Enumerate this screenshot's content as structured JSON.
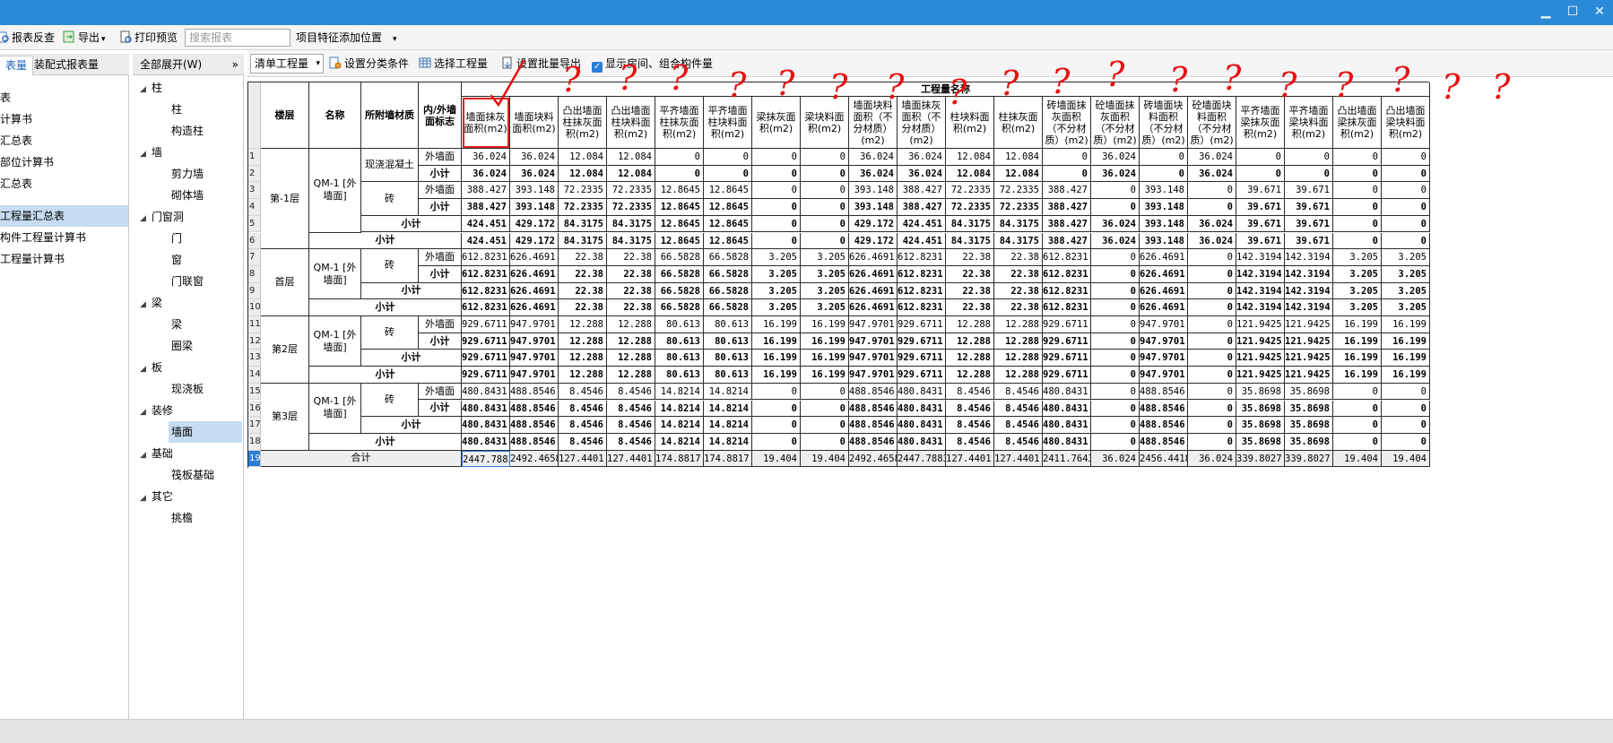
{
  "window": {
    "minimize": "▁",
    "maximize": "☐",
    "close": "✕"
  },
  "toolbar": {
    "report_check": "报表反查",
    "export": "导出",
    "print_preview": "打印预览",
    "search_placeholder": "搜索报表",
    "feature_position": "项目特征添加位置"
  },
  "left_panel": {
    "tabs": [
      "表量",
      "装配式报表量"
    ],
    "items": [
      {
        "label": "表",
        "selected": false
      },
      {
        "label": "计算书",
        "selected": false
      },
      {
        "label": "汇总表",
        "selected": false
      },
      {
        "label": "部位计算书",
        "selected": false
      },
      {
        "label": "汇总表",
        "selected": false
      },
      {
        "label": "工程量汇总表",
        "selected": true
      },
      {
        "label": "构件工程量计算书",
        "selected": false
      },
      {
        "label": "工程量计算书",
        "selected": false
      }
    ]
  },
  "tree": {
    "expand_all": "全部展开(W)",
    "collapse_glyph": "»",
    "nodes": [
      {
        "type": "group",
        "label": "柱"
      },
      {
        "type": "leaf",
        "label": "柱"
      },
      {
        "type": "leaf",
        "label": "构造柱"
      },
      {
        "type": "group",
        "label": "墙"
      },
      {
        "type": "leaf",
        "label": "剪力墙"
      },
      {
        "type": "leaf",
        "label": "砌体墙"
      },
      {
        "type": "group",
        "label": "门窗洞"
      },
      {
        "type": "leaf",
        "label": "门"
      },
      {
        "type": "leaf",
        "label": "窗"
      },
      {
        "type": "leaf",
        "label": "门联窗"
      },
      {
        "type": "group",
        "label": "梁"
      },
      {
        "type": "leaf",
        "label": "梁"
      },
      {
        "type": "leaf",
        "label": "圈梁"
      },
      {
        "type": "group",
        "label": "板"
      },
      {
        "type": "leaf",
        "label": "现浇板"
      },
      {
        "type": "group",
        "label": "装修"
      },
      {
        "type": "leaf",
        "label": "墙面",
        "selected": true
      },
      {
        "type": "group",
        "label": "基础"
      },
      {
        "type": "leaf",
        "label": "筏板基础"
      },
      {
        "type": "group",
        "label": "其它"
      },
      {
        "type": "leaf",
        "label": "挑檐"
      }
    ]
  },
  "report_toolbar": {
    "mode_select": "清单工程量",
    "set_category": "设置分类条件",
    "select_quantity": "选择工程量",
    "batch_export": "设置批量导出",
    "show_rooms": "显示房间、组合构件量",
    "show_rooms_checked": true
  },
  "table": {
    "group_header": "工程量名称",
    "fixed_headers": [
      "楼层",
      "名称",
      "所附墙材质",
      "内/外墙面标志"
    ],
    "columns": [
      "墙面抹灰面积(m2)",
      "墙面块料面积(m2)",
      "凸出墙面柱抹灰面积(m2)",
      "凸出墙面柱块料面积(m2)",
      "平齐墙面柱抹灰面积(m2)",
      "平齐墙面柱块料面积(m2)",
      "梁抹灰面积(m2)",
      "梁块料面积(m2)",
      "墙面块料面积（不分材质）(m2)",
      "墙面抹灰面积（不分材质）(m2)",
      "柱块料面积(m2)",
      "柱抹灰面积(m2)",
      "砖墙面抹灰面积（不分材质）(m2)",
      "砼墙面抹灰面积（不分材质）(m2)",
      "砖墙面块料面积（不分材质）(m2)",
      "砼墙面块料面积（不分材质）(m2)",
      "平齐墙面梁抹灰面积(m2)",
      "平齐墙面梁块料面积(m2)",
      "凸出墙面梁抹灰面积(m2)",
      "凸出墙面梁块料面积(m2)"
    ],
    "floors": [
      "第-1层",
      "首层",
      "第2层",
      "第3层"
    ],
    "name_label": "QM-1 [外墙面]",
    "materials": {
      "concrete": "现浇混凝土",
      "brick": "砖"
    },
    "flag_outer": "外墙面",
    "subtotal": "小计",
    "total": "合计",
    "row_numbers": [
      "1",
      "2",
      "3",
      "4",
      "5",
      "6",
      "7",
      "8",
      "9",
      "10",
      "11",
      "12",
      "13",
      "14",
      "15",
      "16",
      "17",
      "18",
      "19"
    ],
    "rows": [
      [
        "36.024",
        "36.024",
        "12.084",
        "12.084",
        "0",
        "0",
        "0",
        "0",
        "36.024",
        "36.024",
        "12.084",
        "12.084",
        "0",
        "36.024",
        "0",
        "36.024",
        "0",
        "0",
        "0",
        "0"
      ],
      [
        "36.024",
        "36.024",
        "12.084",
        "12.084",
        "0",
        "0",
        "0",
        "0",
        "36.024",
        "36.024",
        "12.084",
        "12.084",
        "0",
        "36.024",
        "0",
        "36.024",
        "0",
        "0",
        "0",
        "0"
      ],
      [
        "388.427",
        "393.148",
        "72.2335",
        "72.2335",
        "12.8645",
        "12.8645",
        "0",
        "0",
        "393.148",
        "388.427",
        "72.2335",
        "72.2335",
        "388.427",
        "0",
        "393.148",
        "0",
        "39.671",
        "39.671",
        "0",
        "0"
      ],
      [
        "388.427",
        "393.148",
        "72.2335",
        "72.2335",
        "12.8645",
        "12.8645",
        "0",
        "0",
        "393.148",
        "388.427",
        "72.2335",
        "72.2335",
        "388.427",
        "0",
        "393.148",
        "0",
        "39.671",
        "39.671",
        "0",
        "0"
      ],
      [
        "424.451",
        "429.172",
        "84.3175",
        "84.3175",
        "12.8645",
        "12.8645",
        "0",
        "0",
        "429.172",
        "424.451",
        "84.3175",
        "84.3175",
        "388.427",
        "36.024",
        "393.148",
        "36.024",
        "39.671",
        "39.671",
        "0",
        "0"
      ],
      [
        "424.451",
        "429.172",
        "84.3175",
        "84.3175",
        "12.8645",
        "12.8645",
        "0",
        "0",
        "429.172",
        "424.451",
        "84.3175",
        "84.3175",
        "388.427",
        "36.024",
        "393.148",
        "36.024",
        "39.671",
        "39.671",
        "0",
        "0"
      ],
      [
        "612.8231",
        "626.4691",
        "22.38",
        "22.38",
        "66.5828",
        "66.5828",
        "3.205",
        "3.205",
        "626.4691",
        "612.8231",
        "22.38",
        "22.38",
        "612.8231",
        "0",
        "626.4691",
        "0",
        "142.3194",
        "142.3194",
        "3.205",
        "3.205"
      ],
      [
        "612.8231",
        "626.4691",
        "22.38",
        "22.38",
        "66.5828",
        "66.5828",
        "3.205",
        "3.205",
        "626.4691",
        "612.8231",
        "22.38",
        "22.38",
        "612.8231",
        "0",
        "626.4691",
        "0",
        "142.3194",
        "142.3194",
        "3.205",
        "3.205"
      ],
      [
        "612.8231",
        "626.4691",
        "22.38",
        "22.38",
        "66.5828",
        "66.5828",
        "3.205",
        "3.205",
        "626.4691",
        "612.8231",
        "22.38",
        "22.38",
        "612.8231",
        "0",
        "626.4691",
        "0",
        "142.3194",
        "142.3194",
        "3.205",
        "3.205"
      ],
      [
        "612.8231",
        "626.4691",
        "22.38",
        "22.38",
        "66.5828",
        "66.5828",
        "3.205",
        "3.205",
        "626.4691",
        "612.8231",
        "22.38",
        "22.38",
        "612.8231",
        "0",
        "626.4691",
        "0",
        "142.3194",
        "142.3194",
        "3.205",
        "3.205"
      ],
      [
        "929.6711",
        "947.9701",
        "12.288",
        "12.288",
        "80.613",
        "80.613",
        "16.199",
        "16.199",
        "947.9701",
        "929.6711",
        "12.288",
        "12.288",
        "929.6711",
        "0",
        "947.9701",
        "0",
        "121.9425",
        "121.9425",
        "16.199",
        "16.199"
      ],
      [
        "929.6711",
        "947.9701",
        "12.288",
        "12.288",
        "80.613",
        "80.613",
        "16.199",
        "16.199",
        "947.9701",
        "929.6711",
        "12.288",
        "12.288",
        "929.6711",
        "0",
        "947.9701",
        "0",
        "121.9425",
        "121.9425",
        "16.199",
        "16.199"
      ],
      [
        "929.6711",
        "947.9701",
        "12.288",
        "12.288",
        "80.613",
        "80.613",
        "16.199",
        "16.199",
        "947.9701",
        "929.6711",
        "12.288",
        "12.288",
        "929.6711",
        "0",
        "947.9701",
        "0",
        "121.9425",
        "121.9425",
        "16.199",
        "16.199"
      ],
      [
        "929.6711",
        "947.9701",
        "12.288",
        "12.288",
        "80.613",
        "80.613",
        "16.199",
        "16.199",
        "947.9701",
        "929.6711",
        "12.288",
        "12.288",
        "929.6711",
        "0",
        "947.9701",
        "0",
        "121.9425",
        "121.9425",
        "16.199",
        "16.199"
      ],
      [
        "480.8431",
        "488.8546",
        "8.4546",
        "8.4546",
        "14.8214",
        "14.8214",
        "0",
        "0",
        "488.8546",
        "480.8431",
        "8.4546",
        "8.4546",
        "480.8431",
        "0",
        "488.8546",
        "0",
        "35.8698",
        "35.8698",
        "0",
        "0"
      ],
      [
        "480.8431",
        "488.8546",
        "8.4546",
        "8.4546",
        "14.8214",
        "14.8214",
        "0",
        "0",
        "488.8546",
        "480.8431",
        "8.4546",
        "8.4546",
        "480.8431",
        "0",
        "488.8546",
        "0",
        "35.8698",
        "35.8698",
        "0",
        "0"
      ],
      [
        "480.8431",
        "488.8546",
        "8.4546",
        "8.4546",
        "14.8214",
        "14.8214",
        "0",
        "0",
        "488.8546",
        "480.8431",
        "8.4546",
        "8.4546",
        "480.8431",
        "0",
        "488.8546",
        "0",
        "35.8698",
        "35.8698",
        "0",
        "0"
      ],
      [
        "480.8431",
        "488.8546",
        "8.4546",
        "8.4546",
        "14.8214",
        "14.8214",
        "0",
        "0",
        "488.8546",
        "480.8431",
        "8.4546",
        "8.4546",
        "480.8431",
        "0",
        "488.8546",
        "0",
        "35.8698",
        "35.8698",
        "0",
        "0"
      ],
      [
        "2447.7883",
        "2492.4658",
        "127.4401",
        "127.4401",
        "174.8817",
        "174.8817",
        "19.404",
        "19.404",
        "2492.4658",
        "2447.7883",
        "127.4401",
        "127.4401",
        "2411.7643",
        "36.024",
        "2456.4418",
        "36.024",
        "339.8027",
        "339.8027",
        "19.404",
        "19.404"
      ]
    ]
  },
  "annotations": {
    "check_mark": "✓",
    "question_mark": "?",
    "color": "#e81010"
  },
  "colors": {
    "titlebar": "#2b8ad8",
    "selection": "#c7dcf2",
    "highlight_border": "#e02020"
  }
}
